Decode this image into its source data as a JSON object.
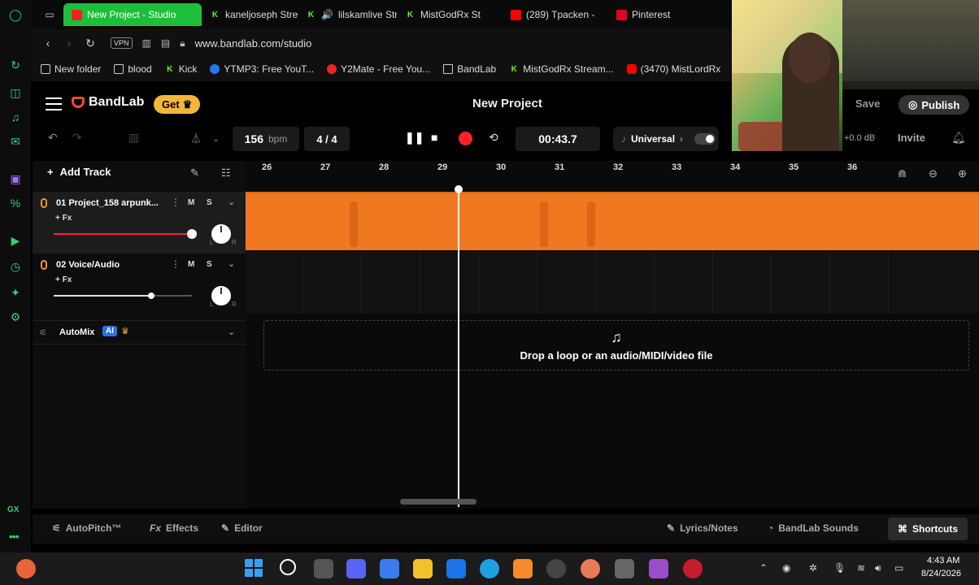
{
  "browser": {
    "tabs": [
      {
        "label": "New Project - Studio",
        "icon": "youtube-live-icon",
        "active": true
      },
      {
        "label": "kaneljoseph Strea",
        "icon": "kick-icon"
      },
      {
        "label": "lilskamlive Str",
        "icon": "kick-icon",
        "audio": true
      },
      {
        "label": "MistGodRx St",
        "icon": "kick-icon"
      },
      {
        "label": "(289) Tpacken -",
        "icon": "youtube-icon"
      },
      {
        "label": "Pinterest",
        "icon": "pinterest-icon"
      }
    ],
    "address": {
      "vpn_label": "VPN",
      "url": "www.bandlab.com/studio"
    },
    "bookmarks": [
      {
        "label": "New folder",
        "icon": "folder-icon"
      },
      {
        "label": "blood",
        "icon": "folder-icon"
      },
      {
        "label": "Kick",
        "icon": "kick-icon"
      },
      {
        "label": "YTMP3: Free YouT...",
        "icon": "download-icon"
      },
      {
        "label": "Y2Mate - Free You...",
        "icon": "y2mate-icon"
      },
      {
        "label": "BandLab",
        "icon": "document-icon"
      },
      {
        "label": "MistGodRx Stream...",
        "icon": "kick-icon"
      },
      {
        "label": "(3470) MistLordRx",
        "icon": "youtube-icon"
      }
    ]
  },
  "bandlab": {
    "logo": "BandLab",
    "get_label": "Get",
    "project_title": "New Project",
    "save_label": "Save",
    "publish_label": "Publish",
    "invite_label": "Invite",
    "master_db": "+0.0 dB",
    "transport": {
      "bpm": "156",
      "bpm_unit": "bpm",
      "time_signature": "4 / 4",
      "time": "00:43.7",
      "key_label": "Universal"
    },
    "add_track_label": "Add Track",
    "tracks": [
      {
        "number": "01",
        "name": "Project_158 arpunk...",
        "fx": "+ Fx",
        "mute": "M",
        "solo": "S",
        "volume": 0.8,
        "pan_l": "L",
        "pan_r": "R"
      },
      {
        "number": "02",
        "name": "Voice/Audio",
        "fx": "+ Fx",
        "mute": "M",
        "solo": "S",
        "volume": 0.68,
        "pan_l": "L",
        "pan_r": "R"
      }
    ],
    "automix": {
      "label": "AutoMix",
      "badge": "AI"
    },
    "ruler": [
      "26",
      "27",
      "28",
      "29",
      "30",
      "31",
      "32",
      "33",
      "34",
      "35",
      "36"
    ],
    "dropzone_text": "Drop a loop or an audio/MIDI/video file",
    "bottom": {
      "autopitch": "AutoPitch™",
      "effects": "Effects",
      "effects_prefix": "Fx",
      "editor": "Editor",
      "lyrics": "Lyrics/Notes",
      "sounds": "BandLab Sounds",
      "shortcuts": "Shortcuts"
    },
    "colors": {
      "accent": "#f07820",
      "record": "#ff2222",
      "get": "#f5b73a",
      "ai": "#2e6fe8"
    }
  },
  "taskbar": {
    "time": "4:43 AM",
    "date": "8/24/2026"
  }
}
